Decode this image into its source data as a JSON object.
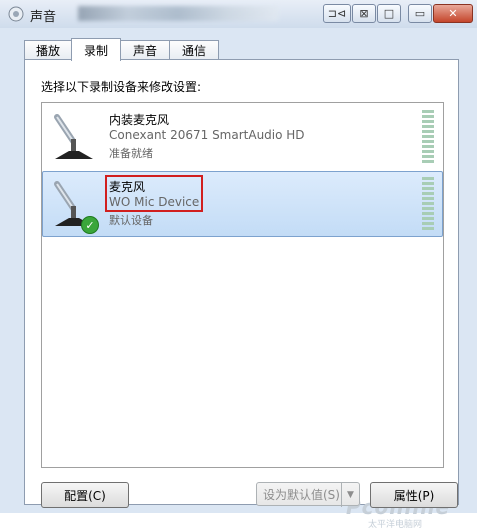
{
  "window": {
    "title": "声音",
    "controls": [
      "⊐⊲",
      "⊠",
      "□",
      "▭",
      "✕"
    ]
  },
  "tabs": [
    {
      "label": "播放",
      "active": false
    },
    {
      "label": "录制",
      "active": true
    },
    {
      "label": "声音",
      "active": false
    },
    {
      "label": "通信",
      "active": false
    }
  ],
  "panel": {
    "instruction": "选择以下录制设备来修改设置:"
  },
  "devices": [
    {
      "name": "内装麦克风",
      "description": "Conexant 20671 SmartAudio HD",
      "status": "准备就绪",
      "selected": false
    },
    {
      "name": "麦克风",
      "description": "WO Mic Device",
      "status": "默认设备",
      "selected": true,
      "default_icon": "green-check-icon"
    }
  ],
  "buttons": {
    "configure": "配置(C)",
    "set_default": "设为默认值(S)",
    "properties": "属性(P)"
  },
  "watermark": {
    "text": "Pconline",
    "sub": "太平洋电脑网"
  },
  "colors": {
    "selection_bg": "#cfe3f8",
    "highlight_border": "#d11f1f",
    "check_green": "#3aa63a"
  }
}
